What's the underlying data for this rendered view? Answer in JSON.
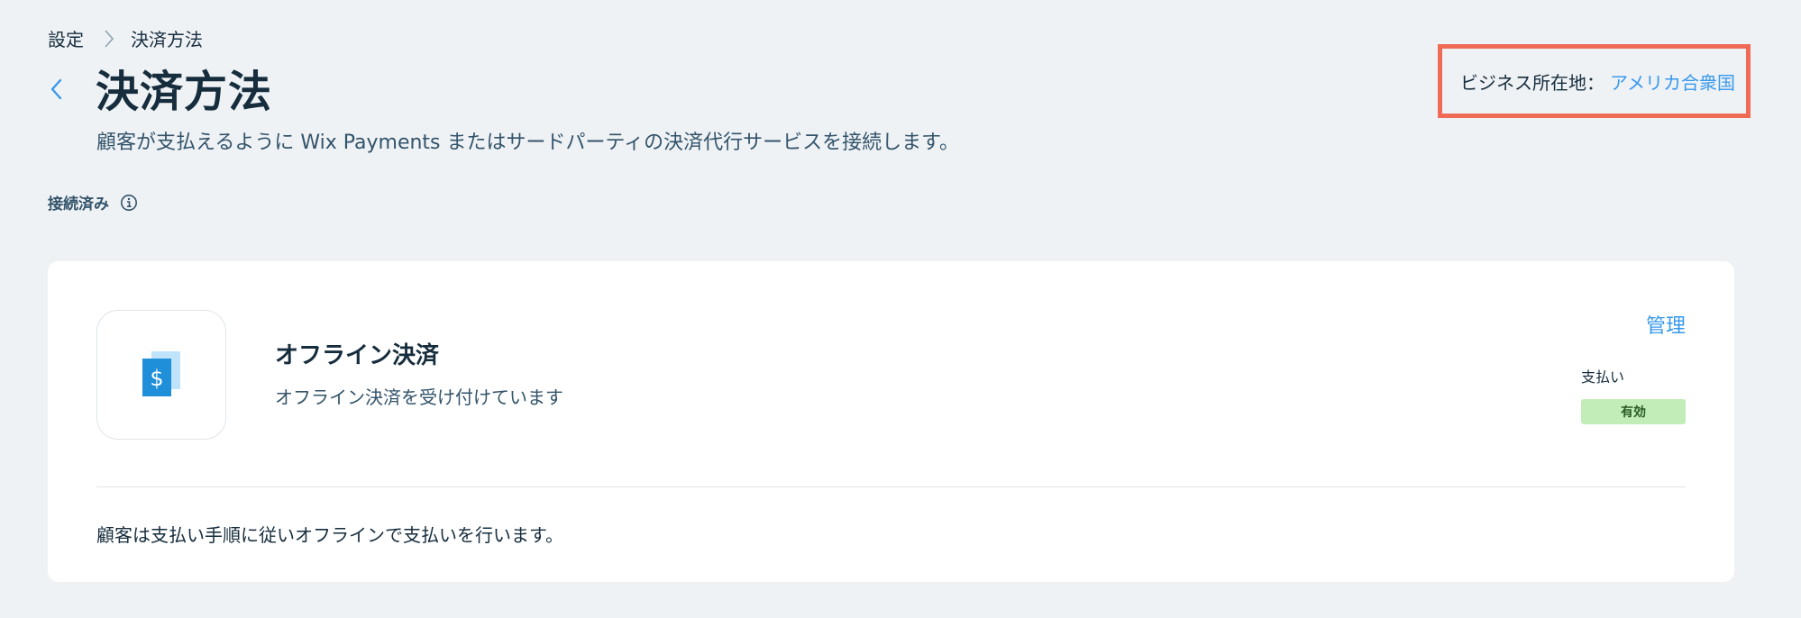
{
  "breadcrumb": {
    "parent": "設定",
    "current": "決済方法"
  },
  "header": {
    "title": "決済方法",
    "subtitle": "顧客が支払えるように Wix Payments またはサードパーティの決済代行サービスを接続します。"
  },
  "business_location": {
    "label": "ビジネス所在地：",
    "value": "アメリカ合衆国"
  },
  "section": {
    "heading": "接続済み"
  },
  "method": {
    "name": "オフライン決済",
    "description": "オフライン決済を受け付けています",
    "manage_label": "管理",
    "payments_label": "支払い",
    "status": "有効",
    "footer_note": "顧客は支払い手順に従いオフラインで支払いを行います。"
  },
  "icons": {
    "back": "chevron-left-icon",
    "breadcrumb_separator": "chevron-right-icon",
    "info": "info-icon",
    "method_logo": "dollar-document-icon"
  },
  "colors": {
    "accent": "#3899ec",
    "highlight_border": "#ef6b55",
    "status_bg": "#c2edb9",
    "background": "#eff2f5"
  }
}
